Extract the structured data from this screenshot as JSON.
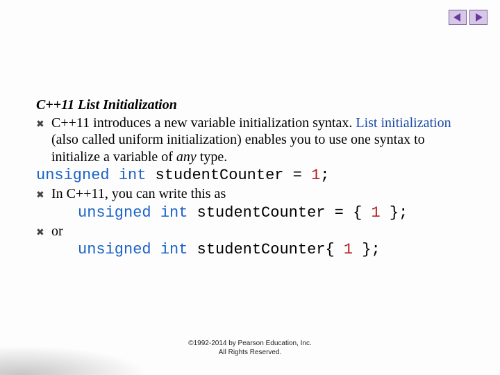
{
  "nav": {
    "prev_icon": "prev-arrow-icon",
    "next_icon": "next-arrow-icon"
  },
  "heading": "C++11 List Initialization",
  "bullets": {
    "b1_a": "C++11 introduces a new variable initialization syntax. ",
    "b1_link": "List initialization",
    "b1_b": " (also called uniform initialization) enables you to use one syntax to initialize a variable of ",
    "b1_ital": "any",
    "b1_c": " type.",
    "b2": "In C++11, you can write this as",
    "b3": "or"
  },
  "code": {
    "kw1": "unsigned int ",
    "line1_rest": "studentCounter = ",
    "line1_num": "1",
    "line1_end": ";",
    "kw2": "unsigned int ",
    "line2_rest": "studentCounter = { ",
    "line2_num": "1",
    "line2_end": " };",
    "kw3": "unsigned int ",
    "line3_rest": "studentCounter{ ",
    "line3_num": "1",
    "line3_end": " };"
  },
  "footer": {
    "line1": "©1992-2014 by Pearson Education, Inc.",
    "line2": "All Rights Reserved."
  }
}
